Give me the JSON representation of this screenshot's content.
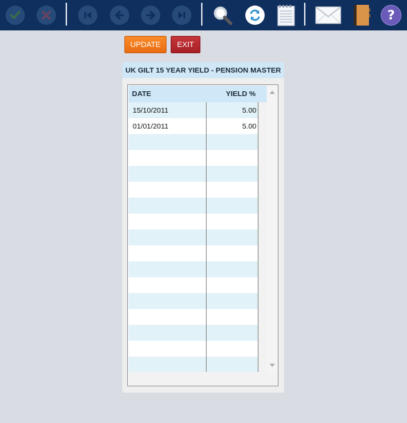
{
  "toolbar": {
    "icons": [
      "check-icon",
      "cross-icon",
      "first-record-icon",
      "previous-record-icon",
      "next-record-icon",
      "last-record-icon",
      "search-icon",
      "refresh-icon",
      "notepad-icon",
      "mail-icon",
      "address-book-icon",
      "help-icon"
    ],
    "help_glyph": "?"
  },
  "actions": {
    "update_label": "UPDATE",
    "exit_label": "EXIT"
  },
  "panel": {
    "title": "UK GILT 15 YEAR YIELD - PENSION MASTER"
  },
  "grid": {
    "columns": [
      "DATE",
      "YIELD %"
    ],
    "rows": [
      {
        "date": "15/10/2011",
        "yield": "5.00"
      },
      {
        "date": "01/01/2011",
        "yield": "5.00"
      }
    ]
  },
  "colors": {
    "toolbar": "#0f2f5e",
    "update_button": "#f57b1c",
    "exit_button": "#b52a30",
    "header": "#cfe7f7",
    "row_alt": "#e1f2f8"
  }
}
